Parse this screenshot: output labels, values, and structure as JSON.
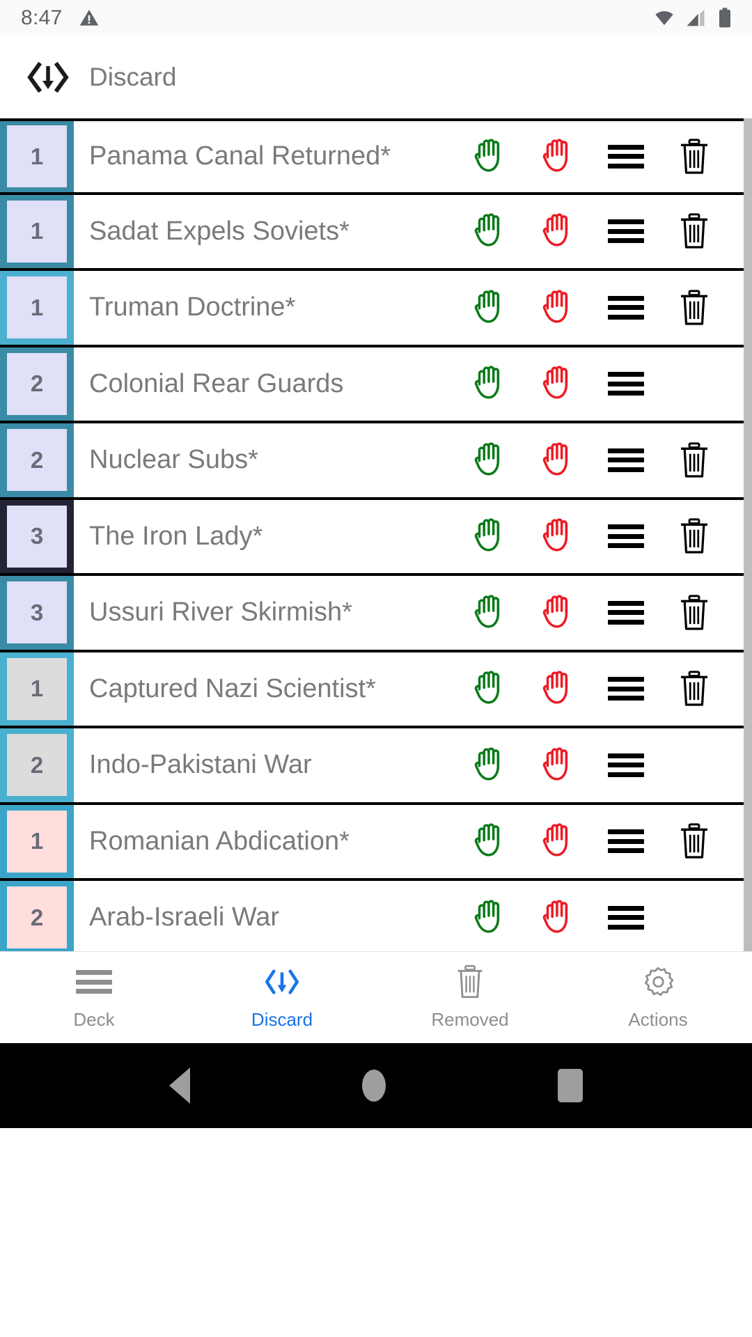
{
  "status_bar": {
    "time": "8:47",
    "icons": [
      "warning-triangle-icon",
      "wifi-icon",
      "cellular-signal-icon",
      "battery-icon"
    ]
  },
  "header": {
    "icon": "discard-chevrons-down-icon",
    "title": "Discard"
  },
  "colors": {
    "accent_blue": "#1a73e8",
    "border_teal_light": "#4bafd0",
    "border_teal_dark": "#3a8ba5",
    "border_navy": "#242336",
    "fill_lavender": "#e0e0f8",
    "fill_gray": "#dcdcdc",
    "fill_pink": "#ffdede",
    "text_gray": "#7a7a7a",
    "row_divider": "#000000"
  },
  "card_list": {
    "rows": [
      {
        "ops": "1",
        "title": "Panama Canal Returned*",
        "border_color": "#3a8ba5",
        "fill_color": "#e0e0f8",
        "has_play_icon": true,
        "has_block_icon": true,
        "has_grip_icon": true,
        "has_trash_icon": true
      },
      {
        "ops": "1",
        "title": "Sadat Expels Soviets*",
        "border_color": "#3a8ba5",
        "fill_color": "#e0e0f8",
        "has_play_icon": true,
        "has_block_icon": true,
        "has_grip_icon": true,
        "has_trash_icon": true
      },
      {
        "ops": "1",
        "title": "Truman Doctrine*",
        "border_color": "#4bafd0",
        "fill_color": "#e0e0f8",
        "has_play_icon": true,
        "has_block_icon": true,
        "has_grip_icon": true,
        "has_trash_icon": true
      },
      {
        "ops": "2",
        "title": "Colonial Rear Guards",
        "border_color": "#3a8ba5",
        "fill_color": "#e0e0f8",
        "has_play_icon": true,
        "has_block_icon": true,
        "has_grip_icon": true,
        "has_trash_icon": false
      },
      {
        "ops": "2",
        "title": "Nuclear Subs*",
        "border_color": "#3a8ba5",
        "fill_color": "#e0e0f8",
        "has_play_icon": true,
        "has_block_icon": true,
        "has_grip_icon": true,
        "has_trash_icon": true
      },
      {
        "ops": "3",
        "title": "The Iron Lady*",
        "border_color": "#242336",
        "fill_color": "#e0e0f8",
        "has_play_icon": true,
        "has_block_icon": true,
        "has_grip_icon": true,
        "has_trash_icon": true
      },
      {
        "ops": "3",
        "title": "Ussuri River Skirmish*",
        "border_color": "#3a8ba5",
        "fill_color": "#e0e0f8",
        "has_play_icon": true,
        "has_block_icon": true,
        "has_grip_icon": true,
        "has_trash_icon": true
      },
      {
        "ops": "1",
        "title": "Captured Nazi Scientist*",
        "border_color": "#4bafd0",
        "fill_color": "#dcdcdc",
        "has_play_icon": true,
        "has_block_icon": true,
        "has_grip_icon": true,
        "has_trash_icon": true
      },
      {
        "ops": "2",
        "title": "Indo-Pakistani War",
        "border_color": "#4bafd0",
        "fill_color": "#dcdcdc",
        "has_play_icon": true,
        "has_block_icon": true,
        "has_grip_icon": true,
        "has_trash_icon": false
      },
      {
        "ops": "1",
        "title": "Romanian Abdication*",
        "border_color": "#3aa5c8",
        "fill_color": "#ffdede",
        "has_play_icon": true,
        "has_block_icon": true,
        "has_grip_icon": true,
        "has_trash_icon": true
      },
      {
        "ops": "2",
        "title": "Arab-Israeli War",
        "border_color": "#3aa5c8",
        "fill_color": "#ffdede",
        "has_play_icon": true,
        "has_block_icon": true,
        "has_grip_icon": true,
        "has_trash_icon": false
      }
    ]
  },
  "bottom_nav": {
    "items": [
      {
        "label": "Deck",
        "icon": "hamburger-icon",
        "active": false
      },
      {
        "label": "Discard",
        "icon": "discard-chevrons-down-icon",
        "active": true
      },
      {
        "label": "Removed",
        "icon": "trash-icon",
        "active": false
      },
      {
        "label": "Actions",
        "icon": "gear-icon",
        "active": false
      }
    ]
  },
  "android_nav": {
    "back": "back-triangle-icon",
    "home": "home-circle-icon",
    "recents": "recents-square-icon"
  }
}
